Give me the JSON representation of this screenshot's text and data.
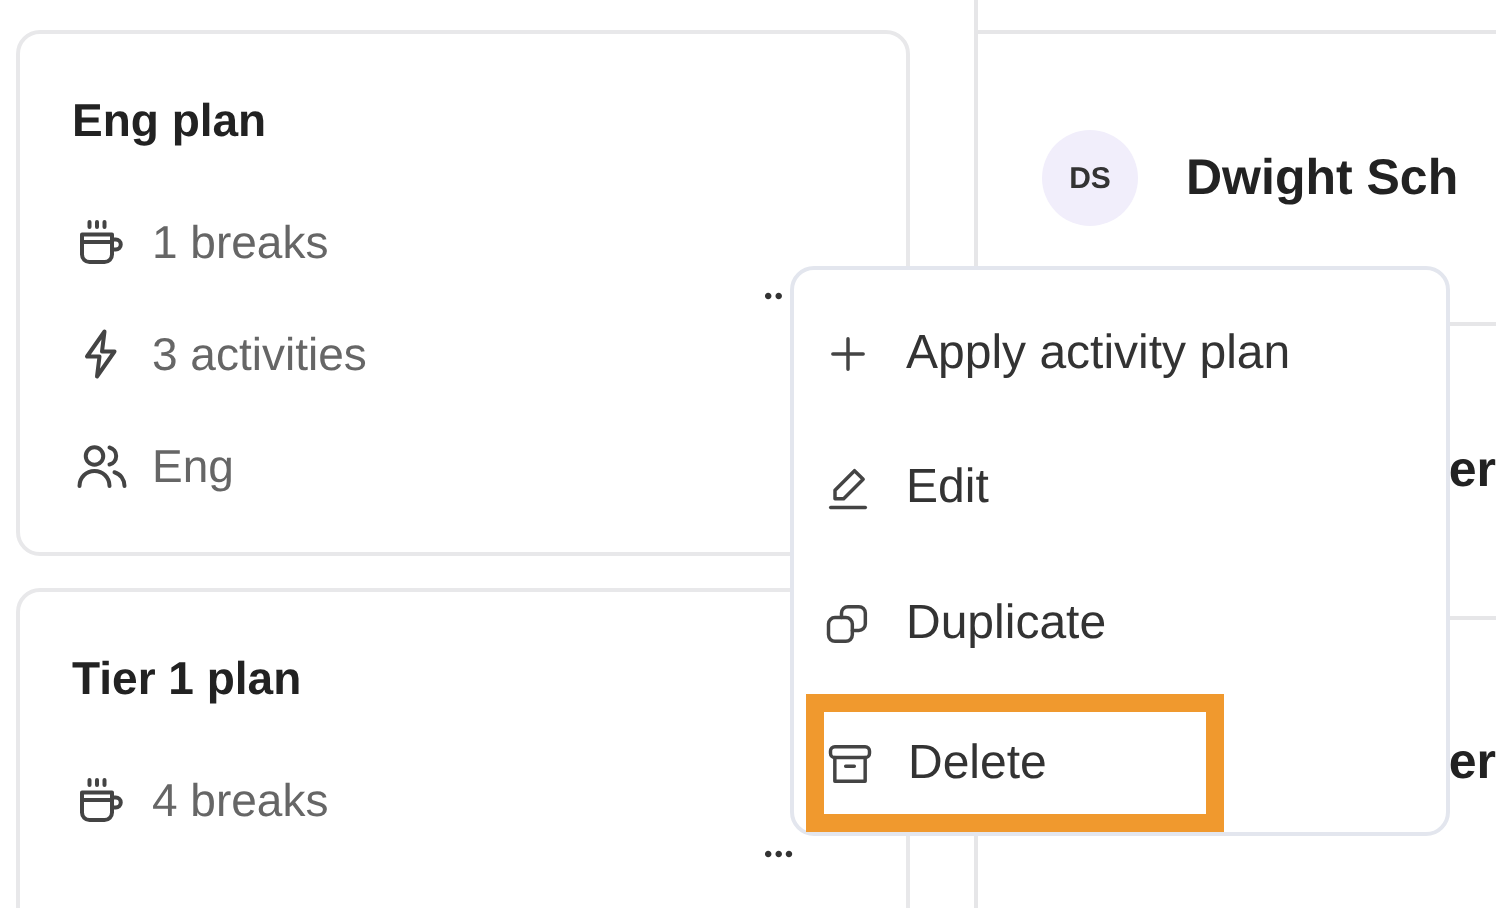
{
  "plans": [
    {
      "title": "Eng plan",
      "details": [
        {
          "kind": "breaks",
          "text": "1 breaks"
        },
        {
          "kind": "activities",
          "text": "3 activities"
        },
        {
          "kind": "team",
          "text": "Eng"
        }
      ],
      "more": "••"
    },
    {
      "title": "Tier 1 plan",
      "details": [
        {
          "kind": "breaks",
          "text": "4 breaks"
        }
      ],
      "more": "•••"
    }
  ],
  "people": [
    {
      "initials": "DS",
      "name": "Dwight Sch"
    },
    {
      "name": "er"
    },
    {
      "name": "er"
    }
  ],
  "menu": [
    {
      "kind": "plus",
      "label": "Apply activity plan",
      "highlighted": false
    },
    {
      "kind": "pencil",
      "label": "Edit",
      "highlighted": false
    },
    {
      "kind": "copy",
      "label": "Duplicate",
      "highlighted": false
    },
    {
      "kind": "archive",
      "label": "Delete",
      "highlighted": true
    }
  ]
}
